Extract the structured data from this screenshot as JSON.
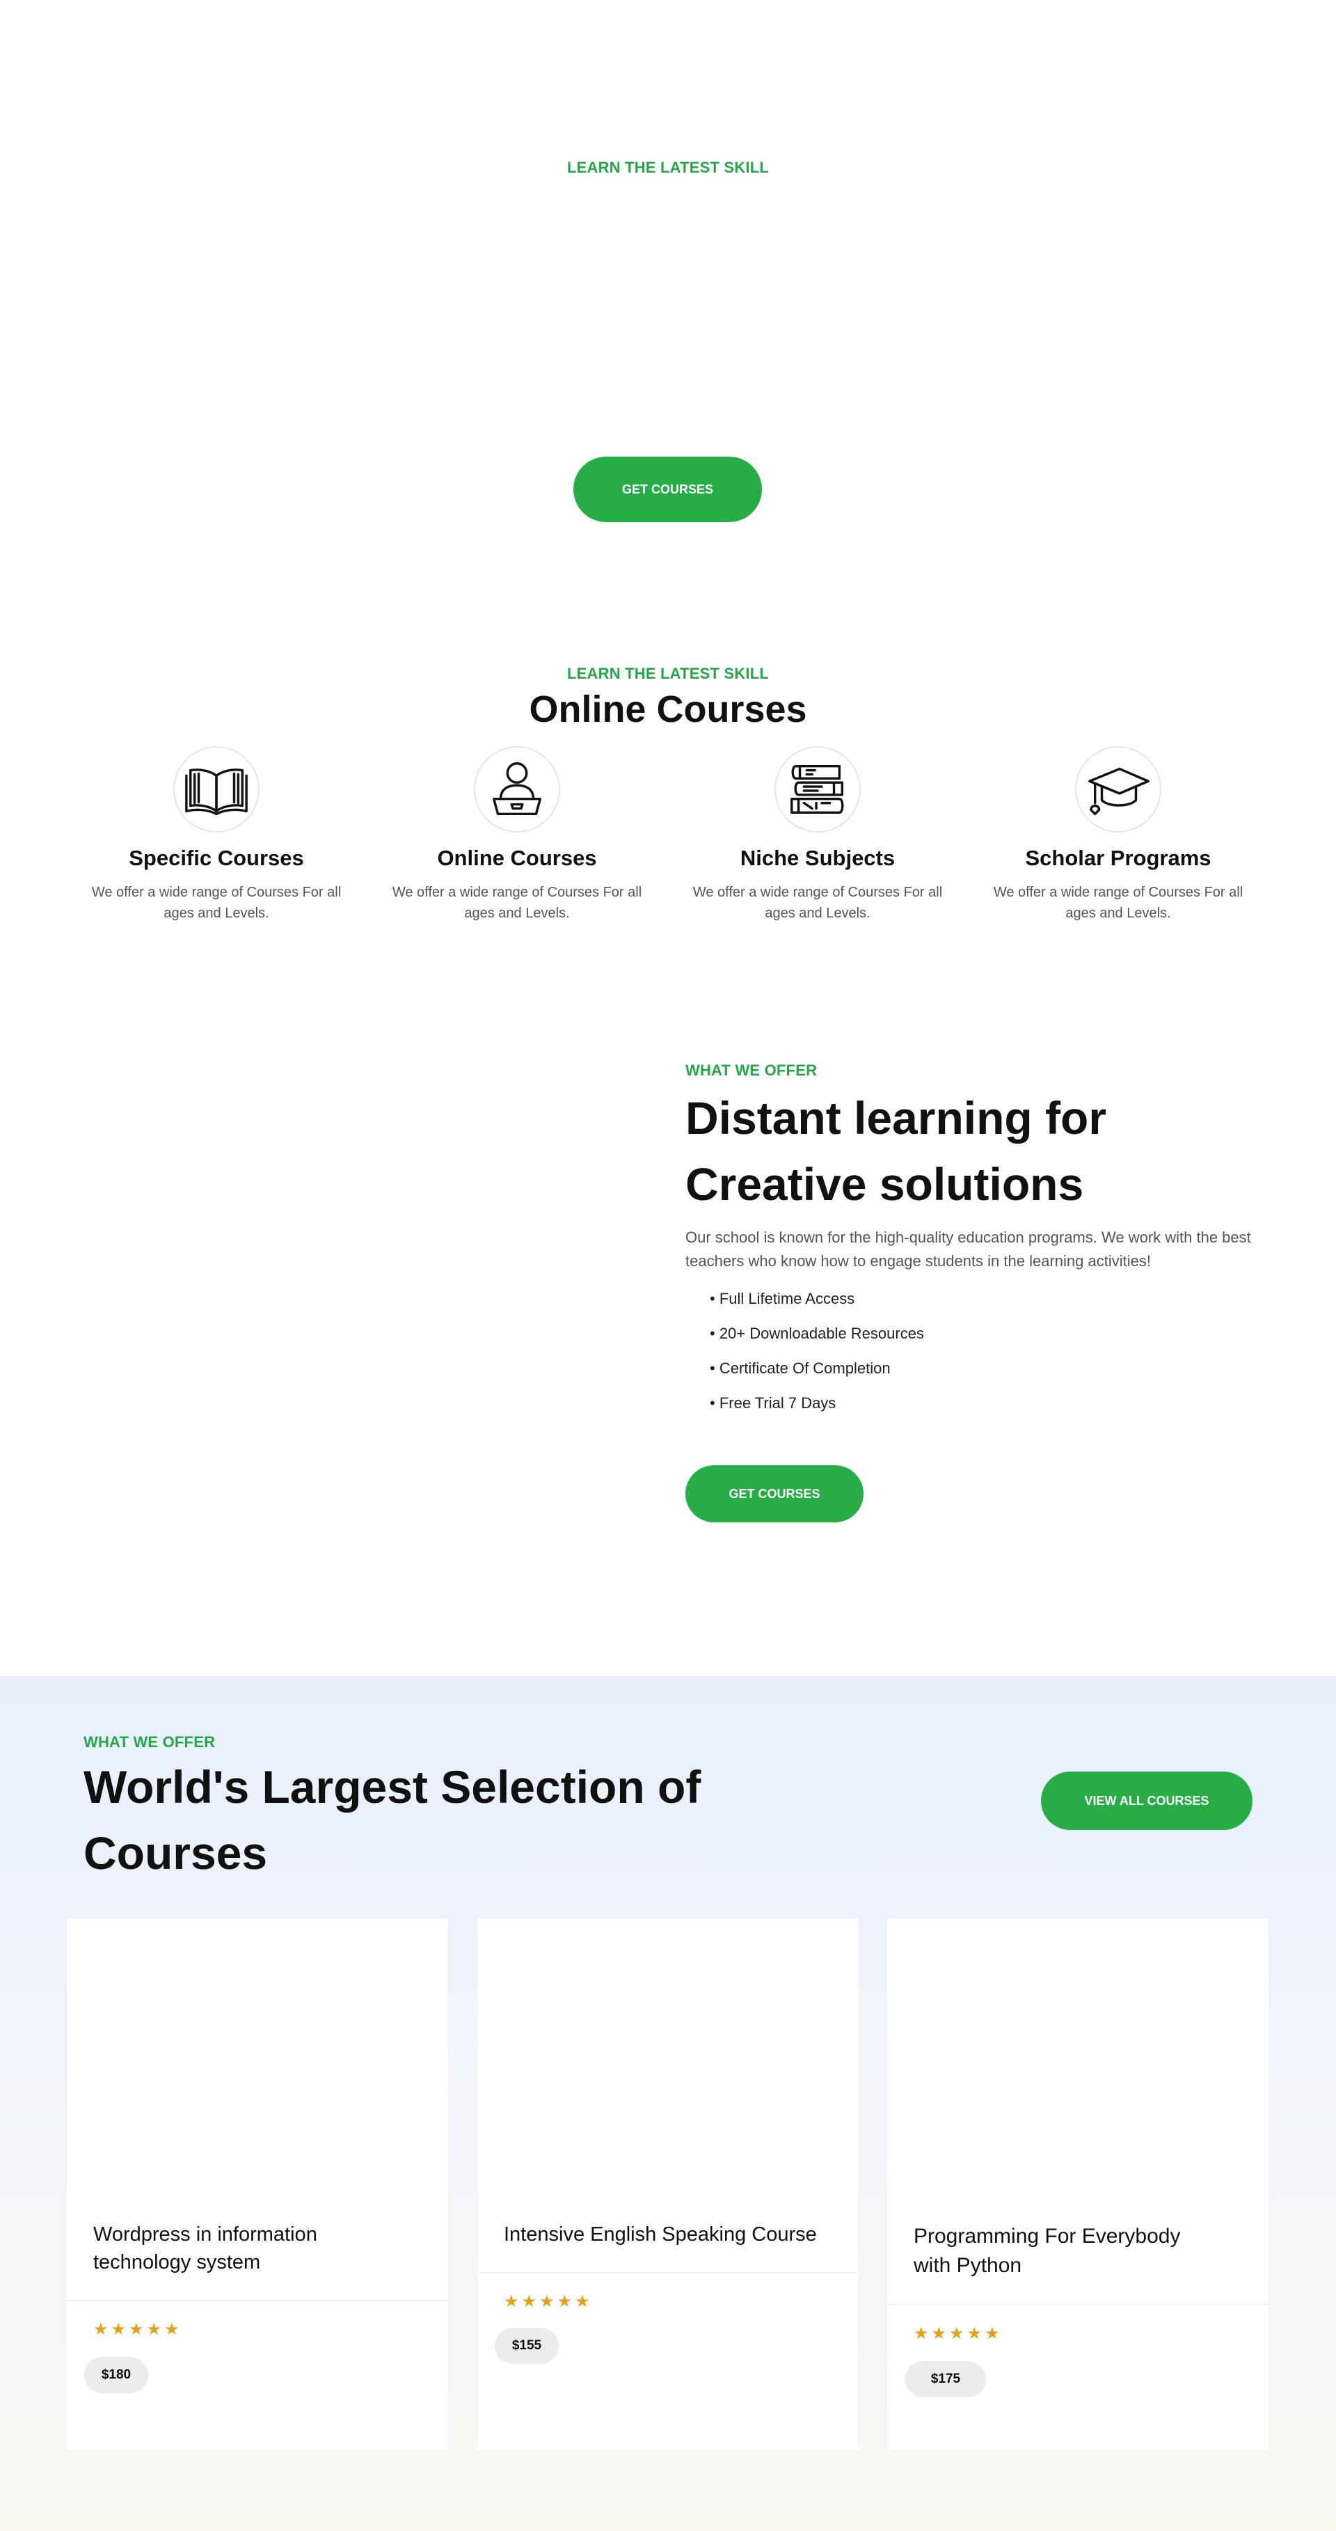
{
  "hero": {
    "label": "LEARN THE LATEST SKILL",
    "button": "GET COURSES"
  },
  "features": {
    "label": "LEARN THE LATEST SKILL",
    "title": "Online Courses",
    "items": [
      {
        "icon": "open-book-icon",
        "title": "Specific Courses",
        "desc": "We offer a wide range of Courses For all ages and Levels."
      },
      {
        "icon": "student-laptop-icon",
        "title": "Online Courses",
        "desc": "We offer a wide range of Courses For all ages and Levels."
      },
      {
        "icon": "book-stack-icon",
        "title": "Niche Subjects",
        "desc": "We offer a wide range of Courses For all ages and Levels."
      },
      {
        "icon": "graduation-cap-icon",
        "title": "Scholar Programs",
        "desc": "We offer a wide range of Courses For all ages and Levels."
      }
    ]
  },
  "offer": {
    "label": "WHAT WE OFFER",
    "title_line1": "Distant learning for",
    "title_line2": "Creative solutions",
    "description": "Our school is known for the high-quality education programs. We work with the best teachers who know how to engage students in the learning activities!",
    "list": [
      "• Full Lifetime Access",
      "• 20+ Downloadable Resources",
      "• Certificate Of Completion",
      "• Free Trial 7 Days"
    ],
    "button": "GET COURSES"
  },
  "courses": {
    "label": "WHAT WE OFFER",
    "title_line1": "World's Largest Selection of",
    "title_line2": "Courses",
    "button": "VIEW ALL COURSES",
    "cards": [
      {
        "title_line1": "Wordpress in information",
        "title_line2": "technology system",
        "stars": "★★★★★",
        "rating": 5,
        "price": "$180"
      },
      {
        "title_line1": "Intensive English Speaking Course",
        "title_line2": "",
        "stars": "★★★★★",
        "rating": 5,
        "price": "$155"
      },
      {
        "title_line1": "Programming For Everybody",
        "title_line2": "with Python",
        "stars": "★★★★★",
        "rating": 5,
        "price": "$175"
      }
    ]
  },
  "colors": {
    "accent": "#27ad45",
    "star": "#e3a21a"
  }
}
